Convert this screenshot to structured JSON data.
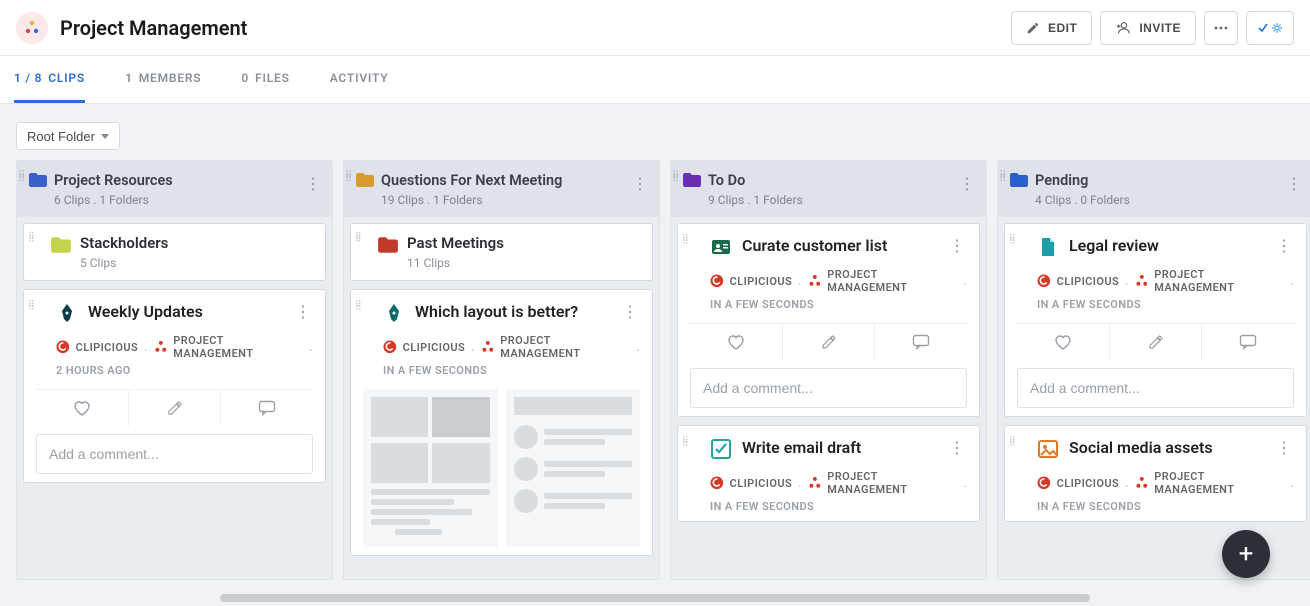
{
  "header": {
    "title": "Project Management",
    "edit_label": "EDIT",
    "invite_label": "INVITE"
  },
  "tabs": {
    "clips": {
      "count": "1 / 8",
      "label": "CLIPS"
    },
    "members": {
      "count": "1",
      "label": "MEMBERS"
    },
    "files": {
      "count": "0",
      "label": "FILES"
    },
    "activity": {
      "label": "ACTIVITY"
    }
  },
  "toolbar": {
    "root_folder_label": "Root Folder"
  },
  "comment_placeholder": "Add a comment...",
  "source": {
    "app": "CLIPICIOUS",
    "board": "PROJECT MANAGEMENT"
  },
  "columns": [
    {
      "name": "Project Resources",
      "meta": "6 Clips . 1 Folders",
      "folder_color": "#3a5fcd",
      "sub_folder": {
        "name": "Stackholders",
        "meta": "5 Clips",
        "color": "#c3d34a"
      },
      "cards": [
        {
          "icon": "pen",
          "icon_color": "#0b3b4a",
          "title": "Weekly Updates",
          "time": "2 HOURS AGO",
          "show_comment": true
        }
      ]
    },
    {
      "name": "Questions For Next Meeting",
      "meta": "19 Clips . 1 Folders",
      "folder_color": "#d69a2d",
      "sub_folder": {
        "name": "Past Meetings",
        "meta": "11 Clips",
        "color": "#c13a2a"
      },
      "cards": [
        {
          "icon": "pen",
          "icon_color": "#0b6b6b",
          "title": "Which layout is better?",
          "time": "IN A FEW SECONDS",
          "wireframe": true
        }
      ]
    },
    {
      "name": "To Do",
      "meta": "9 Clips . 1 Folders",
      "folder_color": "#6a2fb5",
      "cards": [
        {
          "icon": "contact",
          "icon_color": "#1b6b4a",
          "title": "Curate customer list",
          "time": "IN A FEW SECONDS",
          "show_actions": true,
          "show_comment": true
        },
        {
          "icon": "check",
          "icon_color": "#1aa7a0",
          "title": "Write email draft",
          "time": "IN A FEW SECONDS"
        }
      ]
    },
    {
      "name": "Pending",
      "meta": "4 Clips . 0 Folders",
      "folder_color": "#2a5fcd",
      "cards": [
        {
          "icon": "doc",
          "icon_color": "#1a9fa8",
          "title": "Legal review",
          "time": "IN A FEW SECONDS",
          "show_actions": true,
          "show_comment": true
        },
        {
          "icon": "image",
          "icon_color": "#e07b2a",
          "title": "Social media assets",
          "time": "IN A FEW SECONDS"
        }
      ]
    }
  ]
}
